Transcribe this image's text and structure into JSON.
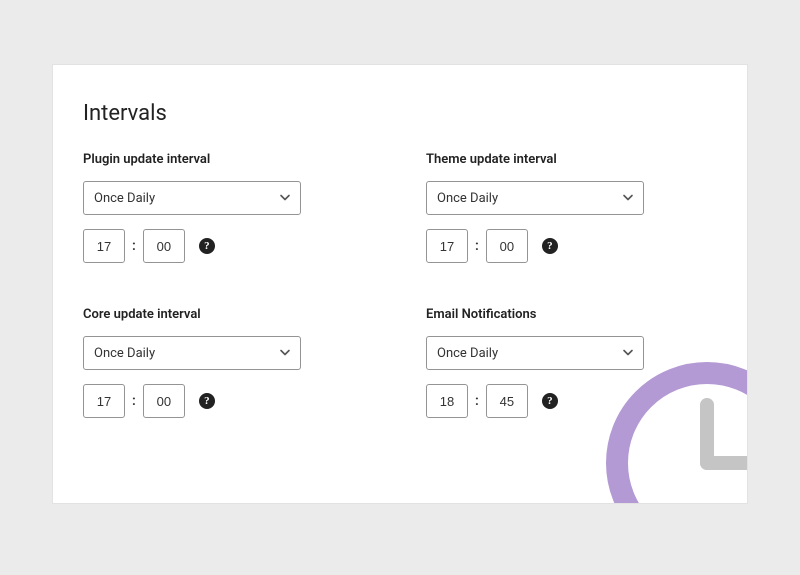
{
  "section": {
    "title": "Intervals"
  },
  "fields": [
    {
      "label": "Plugin update interval",
      "interval": "Once Daily",
      "hour": "17",
      "minute": "00"
    },
    {
      "label": "Theme update interval",
      "interval": "Once Daily",
      "hour": "17",
      "minute": "00"
    },
    {
      "label": "Core update interval",
      "interval": "Once Daily",
      "hour": "17",
      "minute": "00"
    },
    {
      "label": "Email Notifications",
      "interval": "Once Daily",
      "hour": "18",
      "minute": "45"
    }
  ],
  "glyphs": {
    "colon": ":",
    "help": "?"
  },
  "colors": {
    "clockRing": "#b39ad4",
    "clockHands": "#c5c5c5"
  }
}
